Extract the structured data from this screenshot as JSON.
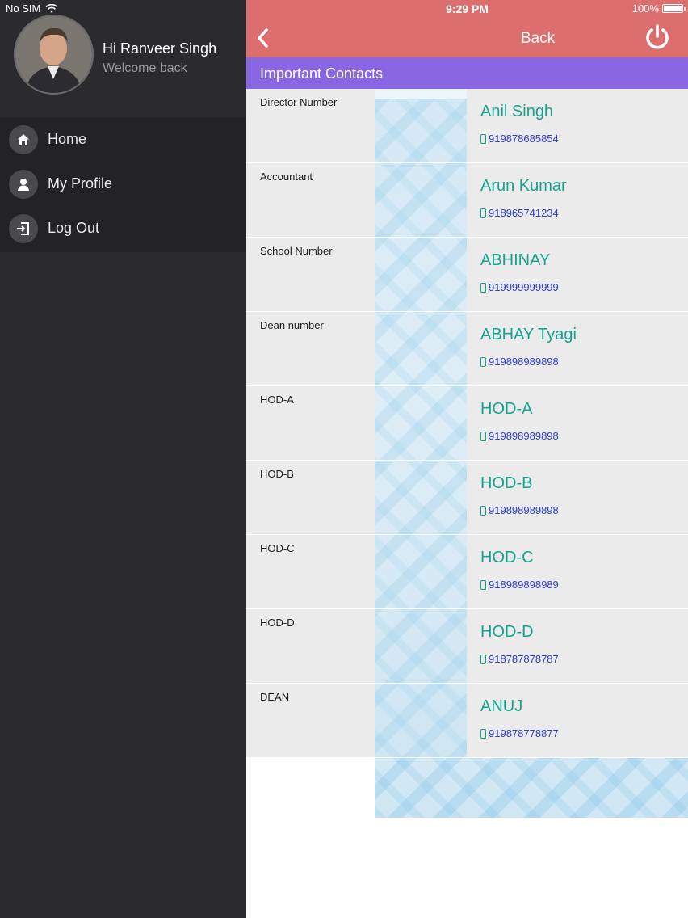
{
  "status": {
    "carrier": "No SIM",
    "time": "9:29 PM",
    "battery": "100%"
  },
  "drawer": {
    "greeting": "Hi Ranveer Singh",
    "subtitle": "Welcome back",
    "items": [
      {
        "label": "Home",
        "icon": "home-icon"
      },
      {
        "label": "My Profile",
        "icon": "user-icon"
      },
      {
        "label": "Log Out",
        "icon": "logout-icon"
      }
    ]
  },
  "header": {
    "back_label": "Back",
    "section_title": "Important Contacts"
  },
  "colors": {
    "header": "#dc6e6e",
    "section": "#8b66e2",
    "name": "#17a48f",
    "phone": "#2d3ed0",
    "drawer": "#2b2a2d"
  },
  "contacts": [
    {
      "role": "Director Number",
      "name": "Anil Singh",
      "phone": "919878685854"
    },
    {
      "role": "Accountant",
      "name": "Arun Kumar",
      "phone": "918965741234"
    },
    {
      "role": "School Number",
      "name": "ABHINAY",
      "phone": "919999999999"
    },
    {
      "role": "Dean number",
      "name": "ABHAY Tyagi",
      "phone": "919898989898"
    },
    {
      "role": "HOD-A",
      "name": "HOD-A",
      "phone": "919898989898"
    },
    {
      "role": "HOD-B",
      "name": "HOD-B",
      "phone": "919898989898"
    },
    {
      "role": "HOD-C",
      "name": "HOD-C",
      "phone": "918989898989"
    },
    {
      "role": "HOD-D",
      "name": "HOD-D",
      "phone": "918787878787"
    },
    {
      "role": "DEAN",
      "name": "ANUJ",
      "phone": "919878778877"
    }
  ]
}
